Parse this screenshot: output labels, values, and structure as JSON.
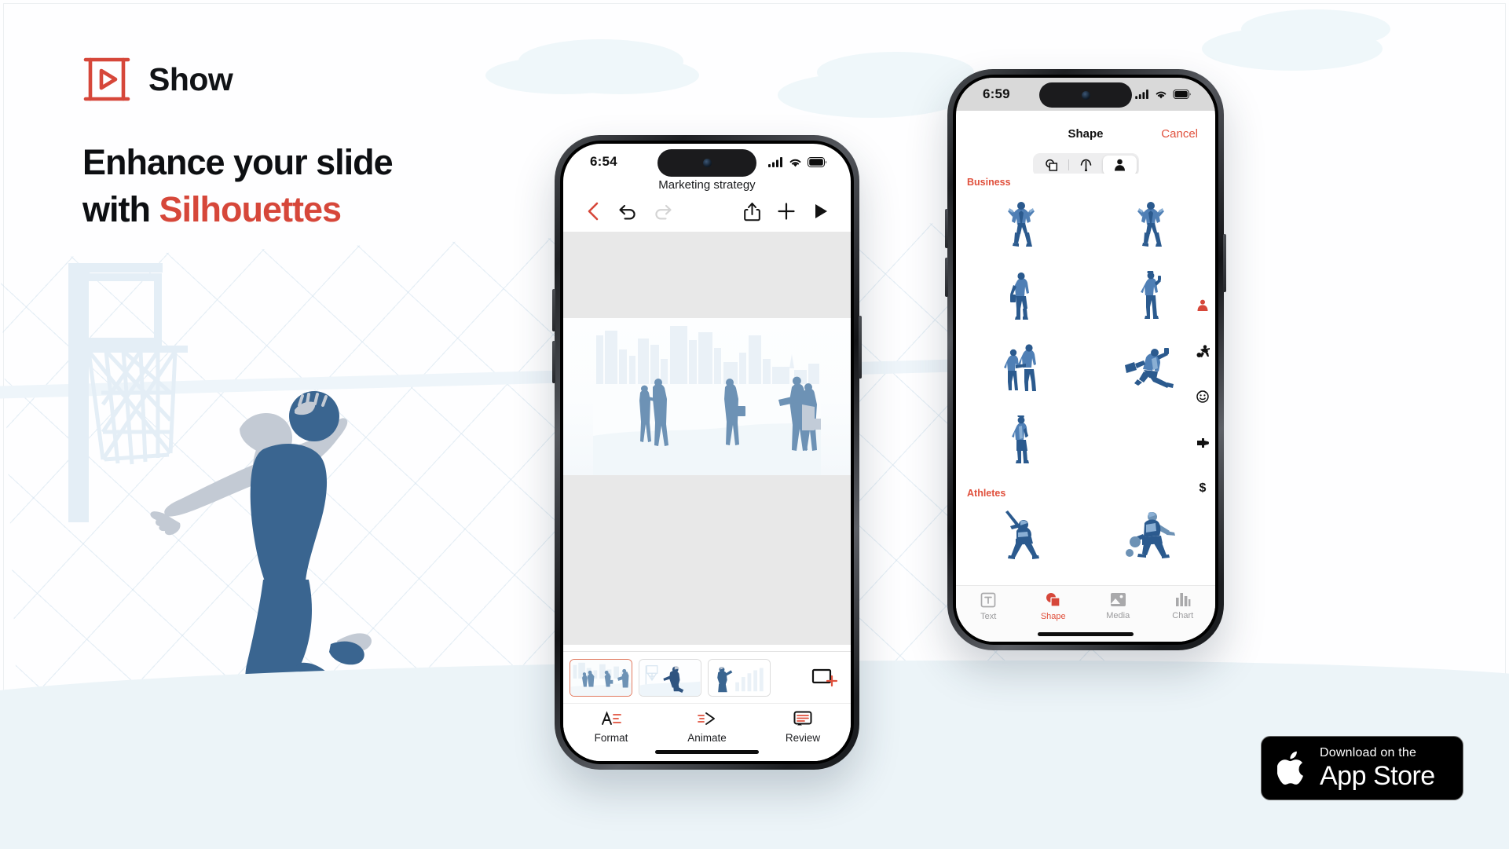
{
  "page": {
    "background_color": "#fefeff",
    "accent_color": "#d6473a",
    "silhouette_dark": "#3a6590",
    "silhouette_light": "#c3cad4"
  },
  "brand": {
    "name": "Show",
    "logo_icon": "presentation-play-icon"
  },
  "headline": {
    "line1": "Enhance your slide",
    "line2_plain": "with ",
    "line2_accent": "Silhouettes"
  },
  "phone_left": {
    "status": {
      "time": "6:54",
      "cellular_icon": "signal-bars-icon",
      "wifi_icon": "wifi-icon",
      "battery_icon": "battery-icon"
    },
    "document_title": "Marketing strategy",
    "toolbar": [
      {
        "name": "back-button",
        "icon": "chevron-left-icon",
        "label": "Back",
        "color": "#e0503c",
        "enabled": true
      },
      {
        "name": "undo-button",
        "icon": "undo-icon",
        "label": "Undo",
        "color": "#111111",
        "enabled": true
      },
      {
        "name": "redo-button",
        "icon": "redo-icon",
        "label": "Redo",
        "color": "#cfcfcf",
        "enabled": false
      },
      {
        "name": "share-button",
        "icon": "share-icon",
        "label": "Share",
        "color": "#111111",
        "enabled": true
      },
      {
        "name": "add-button",
        "icon": "plus-icon",
        "label": "Add",
        "color": "#111111",
        "enabled": true
      },
      {
        "name": "play-button",
        "icon": "play-icon",
        "label": "Play",
        "color": "#111111",
        "enabled": true
      }
    ],
    "slides": [
      {
        "index": 1,
        "name": "slide-thumbnail-business",
        "selected": true
      },
      {
        "index": 2,
        "name": "slide-thumbnail-basketball",
        "selected": false
      },
      {
        "index": 3,
        "name": "slide-thumbnail-chart",
        "selected": false
      }
    ],
    "add_slide_label": "Add slide",
    "tabs": [
      {
        "label": "Format",
        "icon": "text-format-icon"
      },
      {
        "label": "Animate",
        "icon": "animate-icon"
      },
      {
        "label": "Review",
        "icon": "comment-icon"
      }
    ]
  },
  "phone_right": {
    "status": {
      "time": "6:59",
      "cellular_icon": "signal-bars-icon",
      "wifi_icon": "wifi-icon",
      "battery_icon": "battery-icon"
    },
    "nav": {
      "title": "Shape",
      "cancel": "Cancel"
    },
    "segments": [
      {
        "name": "segment-shapes",
        "icon": "shapes-icon",
        "active": false
      },
      {
        "name": "segment-lines",
        "icon": "curve-arrow-icon",
        "active": false
      },
      {
        "name": "segment-people",
        "icon": "person-icon",
        "active": true
      }
    ],
    "categories": [
      {
        "title": "Business",
        "items": [
          {
            "name": "silhouette-celebrating-man-1"
          },
          {
            "name": "silhouette-celebrating-man-2"
          },
          {
            "name": "silhouette-standing-briefcase-man"
          },
          {
            "name": "silhouette-woman-phone"
          },
          {
            "name": "silhouette-two-people-talking"
          },
          {
            "name": "silhouette-running-businessman"
          },
          {
            "name": "silhouette-standing-woman"
          }
        ]
      },
      {
        "title": "Athletes",
        "items": [
          {
            "name": "silhouette-baseball-batter"
          },
          {
            "name": "silhouette-soccer-player"
          }
        ]
      }
    ],
    "index_rail": [
      {
        "name": "index-business-icon",
        "icon": "person-business-icon",
        "active": true
      },
      {
        "name": "index-athletes-icon",
        "icon": "soccer-player-icon",
        "active": false
      },
      {
        "name": "index-faces-icon",
        "icon": "smiley-face-icon",
        "active": false
      },
      {
        "name": "index-hands-icon",
        "icon": "pointing-hand-icon",
        "active": false
      },
      {
        "name": "index-money-icon",
        "icon": "dollar-sign-icon",
        "active": false
      }
    ],
    "tabs": [
      {
        "label": "Text",
        "icon": "text-box-icon",
        "active": false
      },
      {
        "label": "Shape",
        "icon": "shapes-filled-icon",
        "active": true
      },
      {
        "label": "Media",
        "icon": "image-icon",
        "active": false
      },
      {
        "label": "Chart",
        "icon": "bar-chart-icon",
        "active": false
      }
    ]
  },
  "app_store_badge": {
    "small_text": "Download on the",
    "big_text": "App Store",
    "icon": "apple-logo-icon"
  }
}
